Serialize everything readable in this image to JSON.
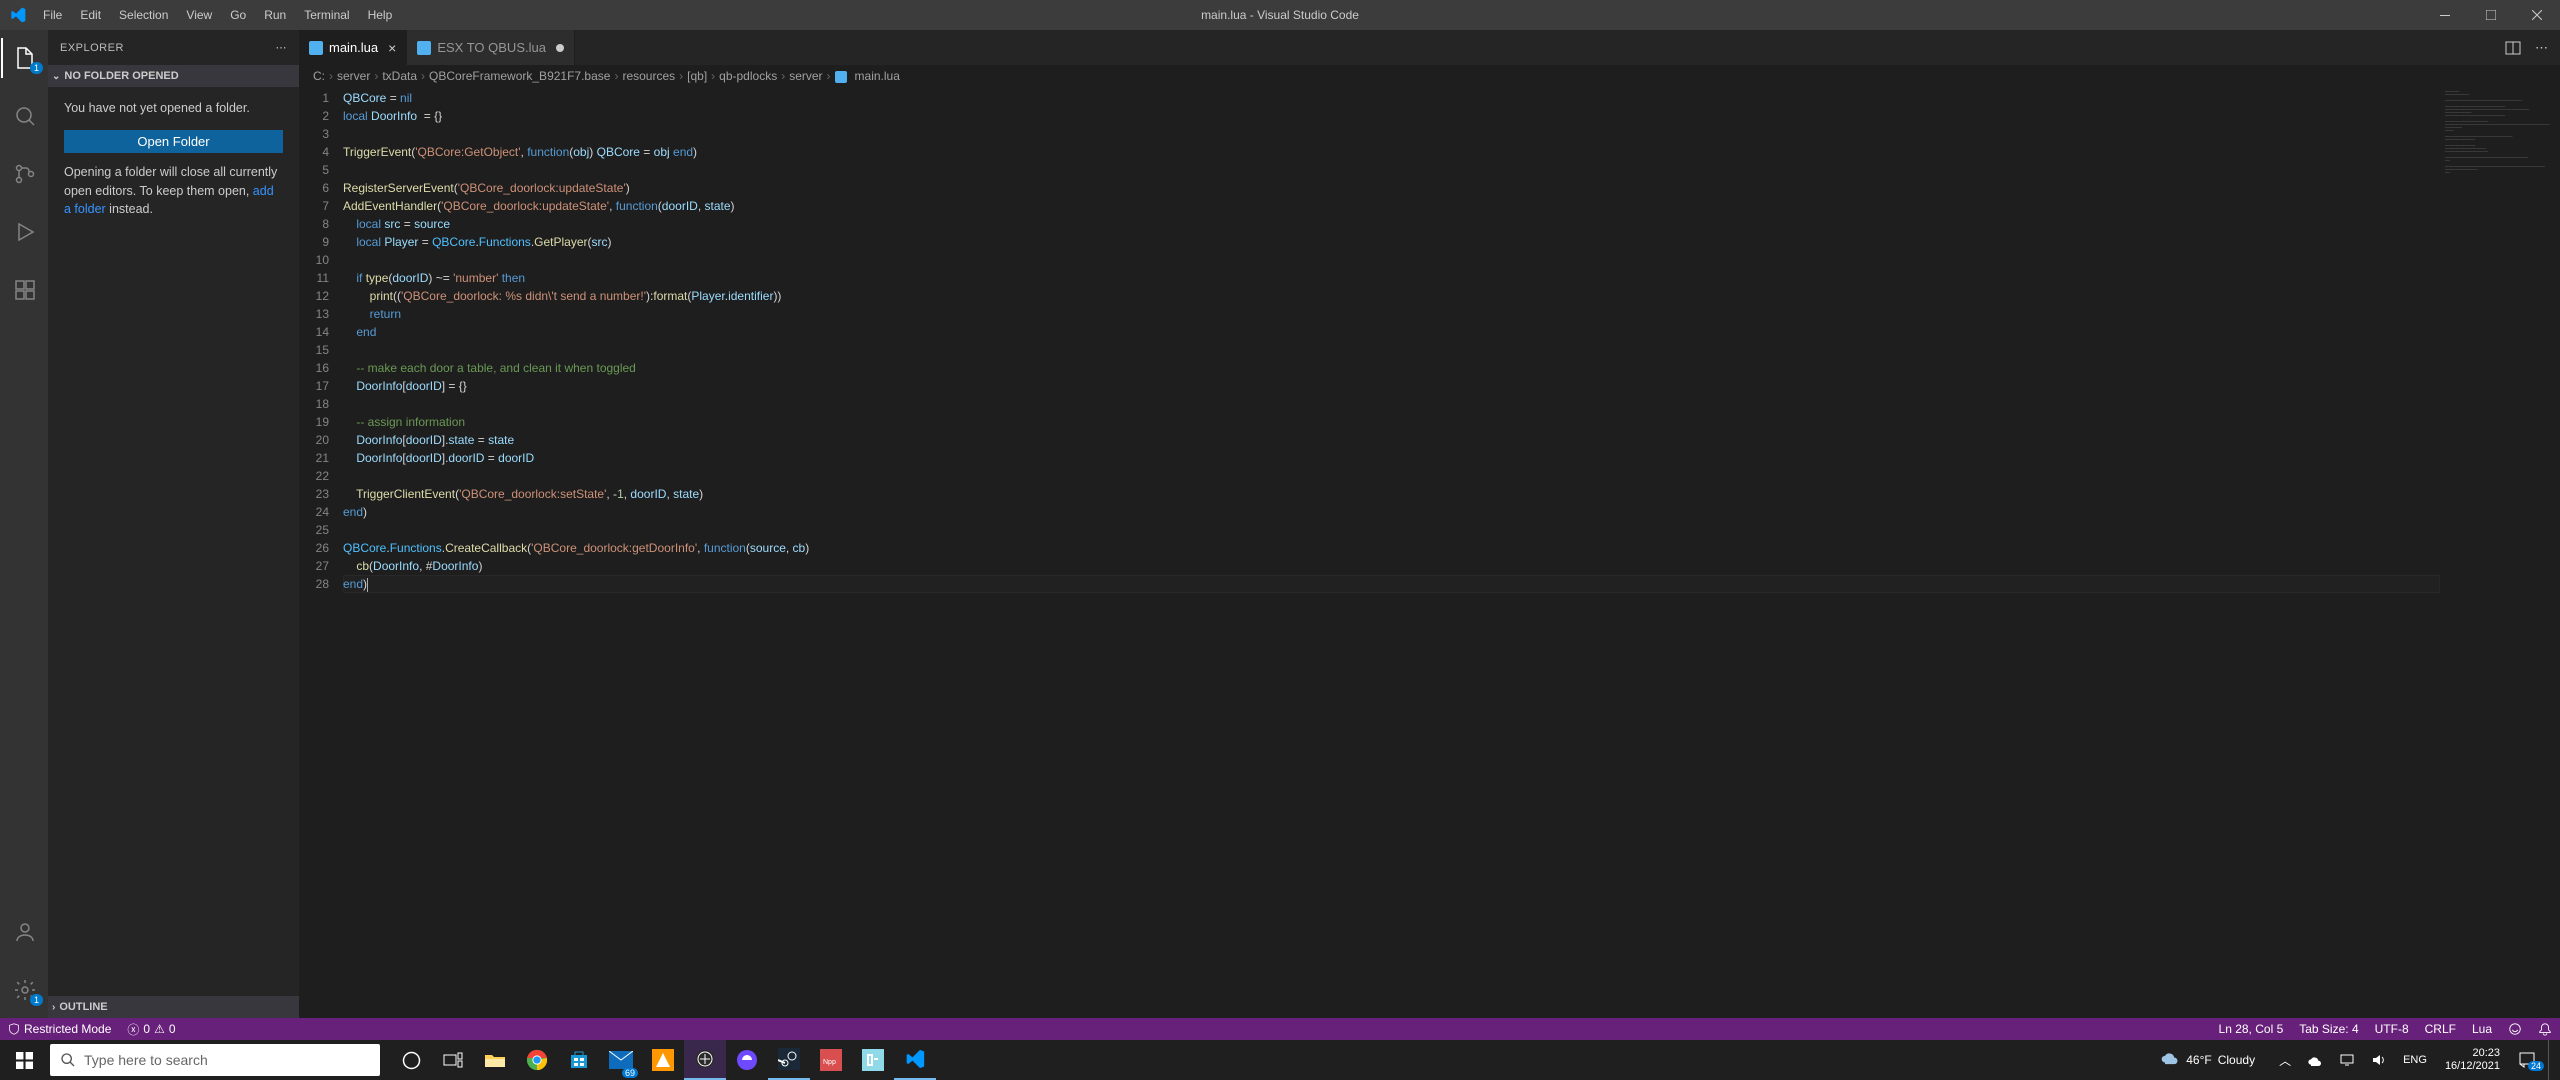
{
  "window": {
    "title": "main.lua - Visual Studio Code"
  },
  "menu": {
    "file": "File",
    "edit": "Edit",
    "selection": "Selection",
    "view": "View",
    "go": "Go",
    "run": "Run",
    "terminal": "Terminal",
    "help": "Help"
  },
  "activity": {
    "explorer_badge": "1",
    "settings_badge": "1"
  },
  "sidebar": {
    "title": "EXPLORER",
    "section": "NO FOLDER OPENED",
    "msg": "You have not yet opened a folder.",
    "open_btn": "Open Folder",
    "hint_prefix": "Opening a folder will close all currently open editors. To keep them open, ",
    "hint_link": "add a folder",
    "hint_suffix": " instead.",
    "outline": "OUTLINE"
  },
  "tabs": [
    {
      "label": "main.lua",
      "icon_color": "#51b0ef",
      "active": true,
      "dirty": false
    },
    {
      "label": "ESX TO QBUS.lua",
      "icon_color": "#51b0ef",
      "active": false,
      "dirty": true
    }
  ],
  "breadcrumbs": [
    "C:",
    "server",
    "txData",
    "QBCoreFramework_B921F7.base",
    "resources",
    "[qb]",
    "qb-pdlocks",
    "server",
    "main.lua"
  ],
  "code": {
    "lines": [
      [
        [
          "var",
          "QBCore"
        ],
        [
          "op",
          " = "
        ],
        [
          "kw",
          "nil"
        ]
      ],
      [
        [
          "kw",
          "local"
        ],
        [
          "op",
          " "
        ],
        [
          "var",
          "DoorInfo"
        ],
        [
          "op",
          "  = {}"
        ]
      ],
      [],
      [
        [
          "fn",
          "TriggerEvent"
        ],
        [
          "op",
          "("
        ],
        [
          "str",
          "'QBCore:GetObject'"
        ],
        [
          "op",
          ", "
        ],
        [
          "kw",
          "function"
        ],
        [
          "op",
          "("
        ],
        [
          "var",
          "obj"
        ],
        [
          "op",
          ") "
        ],
        [
          "var",
          "QBCore"
        ],
        [
          "op",
          " = "
        ],
        [
          "var",
          "obj"
        ],
        [
          "op",
          " "
        ],
        [
          "kw",
          "end"
        ],
        [
          "op",
          ")"
        ]
      ],
      [],
      [
        [
          "fn",
          "RegisterServerEvent"
        ],
        [
          "op",
          "("
        ],
        [
          "str",
          "'QBCore_doorlock:updateState'"
        ],
        [
          "op",
          ")"
        ]
      ],
      [
        [
          "fn",
          "AddEventHandler"
        ],
        [
          "op",
          "("
        ],
        [
          "str",
          "'QBCore_doorlock:updateState'"
        ],
        [
          "op",
          ", "
        ],
        [
          "kw",
          "function"
        ],
        [
          "op",
          "("
        ],
        [
          "var",
          "doorID"
        ],
        [
          "op",
          ", "
        ],
        [
          "var",
          "state"
        ],
        [
          "op",
          ")"
        ]
      ],
      [
        [
          "op",
          "    "
        ],
        [
          "kw",
          "local"
        ],
        [
          "op",
          " "
        ],
        [
          "var",
          "src"
        ],
        [
          "op",
          " = "
        ],
        [
          "var",
          "source"
        ]
      ],
      [
        [
          "op",
          "    "
        ],
        [
          "kw",
          "local"
        ],
        [
          "op",
          " "
        ],
        [
          "var",
          "Player"
        ],
        [
          "op",
          " = "
        ],
        [
          "const",
          "QBCore"
        ],
        [
          "op",
          "."
        ],
        [
          "const",
          "Functions"
        ],
        [
          "op",
          "."
        ],
        [
          "fn",
          "GetPlayer"
        ],
        [
          "op",
          "("
        ],
        [
          "var",
          "src"
        ],
        [
          "op",
          ")"
        ]
      ],
      [],
      [
        [
          "op",
          "    "
        ],
        [
          "kw",
          "if"
        ],
        [
          "op",
          " "
        ],
        [
          "fn",
          "type"
        ],
        [
          "op",
          "("
        ],
        [
          "var",
          "doorID"
        ],
        [
          "op",
          ") ~= "
        ],
        [
          "str",
          "'number'"
        ],
        [
          "op",
          " "
        ],
        [
          "kw",
          "then"
        ]
      ],
      [
        [
          "op",
          "        "
        ],
        [
          "fn",
          "print"
        ],
        [
          "op",
          "(("
        ],
        [
          "str",
          "'QBCore_doorlock: %s didn\\'t send a number!'"
        ],
        [
          "op",
          "):"
        ],
        [
          "fn",
          "format"
        ],
        [
          "op",
          "("
        ],
        [
          "var",
          "Player"
        ],
        [
          "op",
          "."
        ],
        [
          "var",
          "identifier"
        ],
        [
          "op",
          "))"
        ]
      ],
      [
        [
          "op",
          "        "
        ],
        [
          "kw",
          "return"
        ]
      ],
      [
        [
          "op",
          "    "
        ],
        [
          "kw",
          "end"
        ]
      ],
      [],
      [
        [
          "op",
          "    "
        ],
        [
          "cmt",
          "-- make each door a table, and clean it when toggled"
        ]
      ],
      [
        [
          "op",
          "    "
        ],
        [
          "var",
          "DoorInfo"
        ],
        [
          "op",
          "["
        ],
        [
          "var",
          "doorID"
        ],
        [
          "op",
          "] = {}"
        ]
      ],
      [],
      [
        [
          "op",
          "    "
        ],
        [
          "cmt",
          "-- assign information"
        ]
      ],
      [
        [
          "op",
          "    "
        ],
        [
          "var",
          "DoorInfo"
        ],
        [
          "op",
          "["
        ],
        [
          "var",
          "doorID"
        ],
        [
          "op",
          "]."
        ],
        [
          "var",
          "state"
        ],
        [
          "op",
          " = "
        ],
        [
          "var",
          "state"
        ]
      ],
      [
        [
          "op",
          "    "
        ],
        [
          "var",
          "DoorInfo"
        ],
        [
          "op",
          "["
        ],
        [
          "var",
          "doorID"
        ],
        [
          "op",
          "]."
        ],
        [
          "var",
          "doorID"
        ],
        [
          "op",
          " = "
        ],
        [
          "var",
          "doorID"
        ]
      ],
      [],
      [
        [
          "op",
          "    "
        ],
        [
          "fn",
          "TriggerClientEvent"
        ],
        [
          "op",
          "("
        ],
        [
          "str",
          "'QBCore_doorlock:setState'"
        ],
        [
          "op",
          ", -"
        ],
        [
          "num",
          "1"
        ],
        [
          "op",
          ", "
        ],
        [
          "var",
          "doorID"
        ],
        [
          "op",
          ", "
        ],
        [
          "var",
          "state"
        ],
        [
          "op",
          ")"
        ]
      ],
      [
        [
          "kw",
          "end"
        ],
        [
          "op",
          ")"
        ]
      ],
      [],
      [
        [
          "const",
          "QBCore"
        ],
        [
          "op",
          "."
        ],
        [
          "const",
          "Functions"
        ],
        [
          "op",
          "."
        ],
        [
          "fn",
          "CreateCallback"
        ],
        [
          "op",
          "("
        ],
        [
          "str",
          "'QBCore_doorlock:getDoorInfo'"
        ],
        [
          "op",
          ", "
        ],
        [
          "kw",
          "function"
        ],
        [
          "op",
          "("
        ],
        [
          "var",
          "source"
        ],
        [
          "op",
          ", "
        ],
        [
          "var",
          "cb"
        ],
        [
          "op",
          ")"
        ]
      ],
      [
        [
          "op",
          "    "
        ],
        [
          "fn",
          "cb"
        ],
        [
          "op",
          "("
        ],
        [
          "var",
          "DoorInfo"
        ],
        [
          "op",
          ", #"
        ],
        [
          "var",
          "DoorInfo"
        ],
        [
          "op",
          ")"
        ]
      ],
      [
        [
          "kw",
          "end"
        ],
        [
          "op",
          ")"
        ]
      ]
    ],
    "current_line": 28
  },
  "status": {
    "restricted": "Restricted Mode",
    "errors": "0",
    "warnings": "0",
    "ln_col": "Ln 28, Col 5",
    "tab_size": "Tab Size: 4",
    "encoding": "UTF-8",
    "eol": "CRLF",
    "lang": "Lua"
  },
  "taskbar": {
    "search_placeholder": "Type here to search",
    "weather_temp": "46°F",
    "weather_cond": "Cloudy",
    "time": "20:23",
    "date": "16/12/2021",
    "notif": "24"
  }
}
